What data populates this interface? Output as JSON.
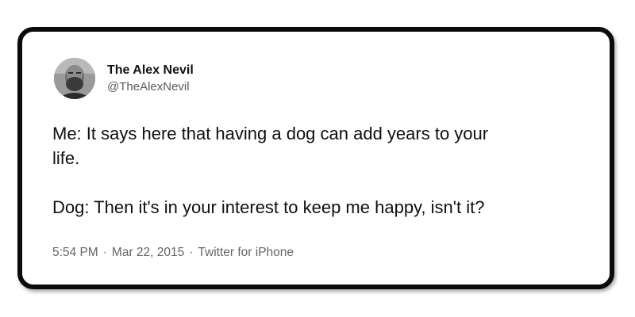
{
  "author": {
    "display_name": "The Alex Nevil",
    "handle": "@TheAlexNevil",
    "avatar_icon": "bearded-man-avatar"
  },
  "tweet": {
    "lines": [
      "Me: It says here that having a dog can add years to your",
      "life.",
      "Dog: Then it's in your interest to keep me happy, isn't it?"
    ]
  },
  "meta": {
    "time": "5:54 PM",
    "separator": "·",
    "date": "Mar 22, 2015",
    "source": "Twitter for iPhone"
  },
  "colors": {
    "border": "#0b0b0b",
    "text": "#0f0f0f",
    "muted": "#666666"
  }
}
